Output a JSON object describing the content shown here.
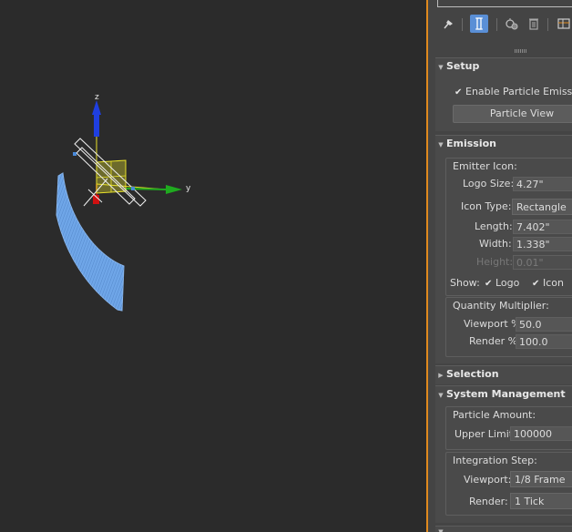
{
  "viewport": {
    "axes": {
      "z": "z",
      "y": "y"
    }
  },
  "panel": {
    "toolbar": {
      "icons": [
        "pin-icon",
        "modifier-stack-icon",
        "configure-icon",
        "delete-icon",
        "editor-icon"
      ]
    },
    "setup": {
      "title": "Setup",
      "enable_label": "Enable Particle Emission",
      "enable_checked": true,
      "particle_view_label": "Particle View"
    },
    "emission": {
      "title": "Emission",
      "emitter_icon_label": "Emitter Icon:",
      "logo_size_label": "Logo Size:",
      "logo_size_value": "4.27\"",
      "icon_type_label": "Icon Type:",
      "icon_type_value": "Rectangle",
      "length_label": "Length:",
      "length_value": "7.402\"",
      "width_label": "Width:",
      "width_value": "1.338\"",
      "height_label": "Height:",
      "height_value": "0.01\"",
      "show_label": "Show:",
      "show_logo_label": "Logo",
      "show_icon_label": "Icon",
      "quantity_label": "Quantity Multiplier:",
      "viewport_pct_label": "Viewport %",
      "viewport_pct_value": "50.0",
      "render_pct_label": "Render %",
      "render_pct_value": "100.0"
    },
    "selection": {
      "title": "Selection"
    },
    "system_management": {
      "title": "System Management",
      "particle_amount_label": "Particle Amount:",
      "upper_limit_label": "Upper Limit:",
      "upper_limit_value": "100000",
      "integration_step_label": "Integration Step:",
      "viewport_label": "Viewport:",
      "viewport_value": "1/8 Frame",
      "render_label": "Render:",
      "render_value": "1 Tick"
    }
  },
  "colors": {
    "viewport_bg": "#2b2b2b",
    "panel_bg": "#444444",
    "accent_orange": "#e08a1e",
    "particle_blue": "#6fa6e8",
    "axis_z": "#1f3fe0",
    "axis_y": "#1faa1f",
    "axis_x": "#d01010",
    "gizmo_yellow": "#e8e22a",
    "toolbar_active": "#5a8fd6"
  }
}
